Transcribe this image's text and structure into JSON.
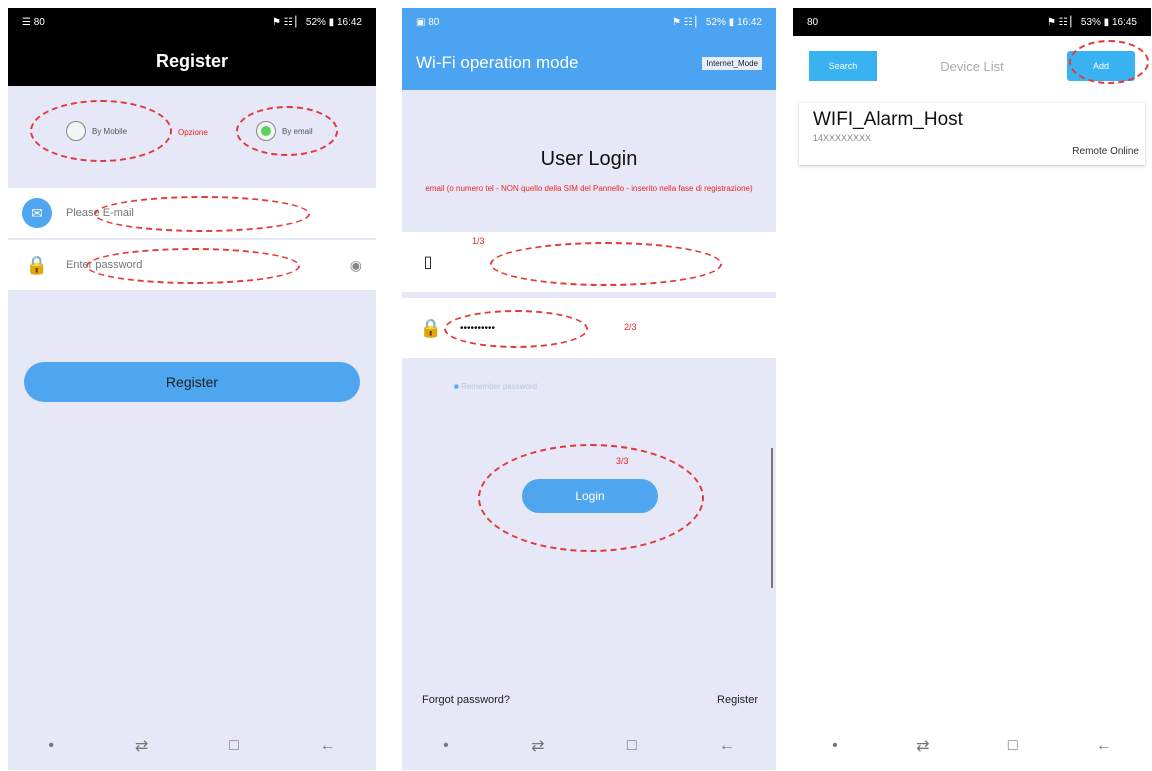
{
  "panel1": {
    "status_left": "☰ 80",
    "status_right": "⚑ ☷ ▏ 52% ▮ 16:42",
    "title": "Register",
    "radio_mobile_label": "By Mobile",
    "radio_email_label": "By email",
    "option_note": "Opzione",
    "email_placeholder": "Please E-mail",
    "password_placeholder": "Enter password",
    "register_button": "Register"
  },
  "panel2": {
    "status_left": "▣ 80",
    "status_right": "⚑ ☷ ▏ 52% ▮ 16:42",
    "title": "Wi-Fi operation mode",
    "title_right": "Internet_Mode",
    "login_heading": "User Login",
    "login_note": "email (o numero tel - NON quello della SIM del Pannello - inserito nella fase di registrazione)",
    "step1": "1/3",
    "password_value": "••••••••••",
    "step2": "2/3",
    "remember_label": "Remember password",
    "step3": "3/3",
    "login_button": "Login",
    "forgot_link": "Forgot password?",
    "register_link": "Register"
  },
  "panel3": {
    "status_left": "80",
    "status_right": "⚑ ☷ ▏ 53% ▮ 16:45",
    "search_button": "Search",
    "title": "Device List",
    "add_button": "Add",
    "device_name": "WIFI_Alarm_Host",
    "device_id": "14XXXXXXXX",
    "device_status": "Remote Online"
  },
  "nav": {
    "dot": "•",
    "recent": "⇄",
    "home": "□",
    "back": "←"
  }
}
